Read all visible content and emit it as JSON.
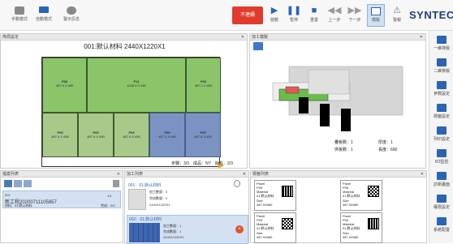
{
  "toolbar": {
    "buttons": [
      {
        "label": "手動模式"
      },
      {
        "label": "自動模式"
      },
      {
        "label": "警示訊息"
      }
    ],
    "stop_label": "不連續",
    "controls": [
      {
        "label": "啟動"
      },
      {
        "label": "暫停"
      },
      {
        "label": "重置"
      },
      {
        "label": "上一步"
      },
      {
        "label": "下一步"
      },
      {
        "label": "模擬"
      },
      {
        "label": "警報"
      }
    ],
    "logo": "SYNTEC"
  },
  "layout_panel": {
    "title": "佈局設定",
    "sheet_title": "001:默认材料 2440X1220X1",
    "parts": [
      {
        "name": "P05",
        "dim": "487.9 X 680"
      },
      {
        "name": "P11",
        "dim": "1036.9 X 680"
      },
      {
        "name": "P03",
        "dim": "487.2 X 680"
      },
      {
        "name": "P05",
        "dim": "487.9 X 680"
      },
      {
        "name": "P05",
        "dim": "487.9 X 680"
      },
      {
        "name": "P05",
        "dim": "487.9 X 680"
      },
      {
        "name": "P05",
        "dim": "487.9 X 680"
      },
      {
        "name": "P05",
        "dim": "487.9 X 680"
      }
    ],
    "status": "步驟：3/3　成品：5/7　餘料：2/3"
  },
  "process_panel": {
    "title": "加工模擬",
    "stats": [
      {
        "label": "疊板數：1",
        "value": "厚度：1"
      },
      {
        "label": "供板數：1",
        "value": "長度：600"
      }
    ]
  },
  "list_panel": {
    "title": "檔案列表",
    "item_id": "001",
    "item_name": "新工程20200711105857",
    "item_sub": "材料：01:默认材料",
    "item_count": "1/1",
    "item_done": "完成：0/0"
  },
  "task_panel": {
    "title": "加工列表",
    "items": [
      {
        "head": "001：01:默认材料",
        "line1": "加工數量：0",
        "line2": "完成數量：0",
        "line3": "2440X1220X1"
      },
      {
        "head": "002：01:默认材料",
        "line1": "加工數量：1",
        "line2": "完成數量：1",
        "line3": "2440X1220X1"
      }
    ]
  },
  "label_panel": {
    "title": "標籤列表",
    "cards": [
      {
        "panel": "Panel",
        "name": "P05",
        "material_label": "Material",
        "material": "01:默认材料",
        "size_label": "Size",
        "size": "487.9X680"
      },
      {
        "panel": "Panel",
        "name": "P05",
        "material_label": "Material",
        "material": "01:默认材料",
        "size_label": "Size",
        "size": "487.9X680"
      },
      {
        "panel": "Panel",
        "name": "P05",
        "material_label": "Material",
        "material": "01:默认材料",
        "size_label": "Size",
        "size": "487.9X680"
      },
      {
        "panel": "Panel",
        "name": "P05",
        "material_label": "Material",
        "material": "01:默认材料",
        "size_label": "Size",
        "size": "487.9X680"
      }
    ]
  },
  "sidebar": {
    "items": [
      {
        "label": "一維排版"
      },
      {
        "label": "二維排版"
      },
      {
        "label": "參數設定"
      },
      {
        "label": "標籤設定"
      },
      {
        "label": "列印設定"
      },
      {
        "label": "I/O監控"
      },
      {
        "label": "診斷畫面"
      },
      {
        "label": "權限設定"
      },
      {
        "label": "系統配置"
      }
    ]
  }
}
